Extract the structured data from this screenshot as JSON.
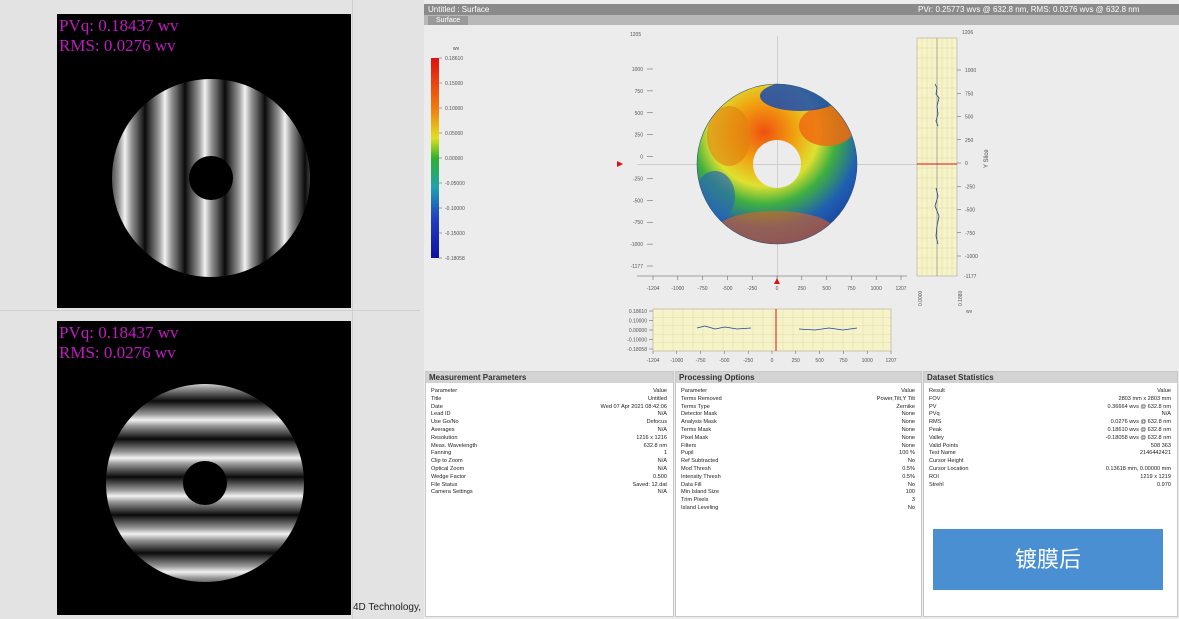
{
  "fringe_panels": [
    {
      "pvq": "PVq: 0.18437 wv",
      "rms": "RMS: 0.0276 wv",
      "fringe_orientation": "vertical"
    },
    {
      "pvq": "PVq: 0.18437 wv",
      "rms": "RMS: 0.0276 wv",
      "fringe_orientation": "horizontal"
    }
  ],
  "brand_text": "4D Technology,",
  "window": {
    "title": "Untitled : Surface",
    "stats_line": "PVr: 0.25773 wvs @ 632.8 nm, RMS: 0.0276 wvs @ 632.8 nm",
    "tab_label": "Surface"
  },
  "colorbar": {
    "unit": "wv",
    "ticks": [
      "0.18610",
      "0.15000",
      "0.10000",
      "0.05000",
      "0.00000",
      "-0.05000",
      "-0.10000",
      "-0.15000",
      "-0.18058"
    ]
  },
  "surface_map": {
    "y_ticks": [
      "1000",
      "750",
      "500",
      "250",
      "0",
      "-250",
      "-500",
      "-750",
      "-1000",
      "-1177"
    ],
    "x_ticks": [
      "-1204",
      "-1000",
      "-750",
      "-500",
      "-250",
      "0",
      "250",
      "500",
      "750",
      "1000",
      "1207"
    ],
    "top_label": "1205"
  },
  "y_slice": {
    "axis_title": "Y Slice",
    "y_ticks": [
      "1000",
      "750",
      "500",
      "250",
      "0",
      "-250",
      "-500",
      "-750",
      "-1000"
    ],
    "top_label": "1206",
    "bottom_label": "-1177",
    "x_min_label": "0.0000",
    "x_max_label": "0.1880",
    "unit": "wv"
  },
  "x_slice": {
    "y_ticks": [
      "0.18610",
      "0.10000",
      "0.00000",
      "-0.10000",
      "-0.18058"
    ],
    "x_ticks": [
      "-1204",
      "-1000",
      "-750",
      "-500",
      "-250",
      "0",
      "250",
      "500",
      "750",
      "1000",
      "1207"
    ]
  },
  "measurement_parameters": {
    "title": "Measurement Parameters",
    "header": [
      "Parameter",
      "Value"
    ],
    "rows": [
      [
        "Title",
        "Untitled"
      ],
      [
        "Date",
        "Wed 07 Apr 2021 08:42:06"
      ],
      [
        "Lead ID",
        "N/A"
      ],
      [
        "Use Go/No",
        "Defocus"
      ],
      [
        "Averages",
        "N/A"
      ],
      [
        "Resolution",
        "1216 x 1216"
      ],
      [
        "Meas. Wavelength",
        "632.8 nm"
      ],
      [
        "Fanning",
        "1"
      ],
      [
        "Clip to Zoom",
        "N/A"
      ],
      [
        "Optical Zoom",
        "N/A"
      ],
      [
        "Wedge Factor",
        "0.500"
      ],
      [
        "File Status",
        "Saved: 12.dat"
      ],
      [
        "Camera Settings",
        "N/A"
      ]
    ]
  },
  "processing_options": {
    "title": "Processing Options",
    "header": [
      "Parameter",
      "Value"
    ],
    "rows": [
      [
        "Terms Removed",
        "Power,Tilt,Y Tilt"
      ],
      [
        "Terms Type",
        "Zernike"
      ],
      [
        "Detector Mask",
        "None"
      ],
      [
        "Analysis Mask",
        "None"
      ],
      [
        "Terms Mask",
        "None"
      ],
      [
        "Pixel Mask",
        "None"
      ],
      [
        "Filters",
        "None"
      ],
      [
        "Pupil",
        "100 %"
      ],
      [
        "Ref Subtracted",
        "No"
      ],
      [
        "Mod Thresh",
        "0.5%"
      ],
      [
        "Intensity Thresh",
        "0.5%"
      ],
      [
        "Data Fill",
        "No"
      ],
      [
        "Min Island Size",
        "100"
      ],
      [
        "Trim Pixels",
        "3"
      ],
      [
        "Island Leveling",
        "No"
      ]
    ]
  },
  "dataset_statistics": {
    "title": "Dataset Statistics",
    "header": [
      "Result",
      "Value"
    ],
    "rows": [
      [
        "FOV",
        "2803 mm x 2803 mm"
      ],
      [
        "PV",
        "0.36664 wvs @ 632.8 nm"
      ],
      [
        "PVq",
        "N/A"
      ],
      [
        "RMS",
        "0.0276 wvs @ 632.8 nm"
      ],
      [
        "Peak",
        "0.18610 wvs @ 632.8 nm"
      ],
      [
        "Valley",
        "-0.18058 wvs @ 632.8 nm"
      ],
      [
        "Valid Points",
        "508 363"
      ],
      [
        "Test Name",
        "2146442421"
      ],
      [
        "Cursor Height",
        ""
      ],
      [
        "Cursor Location",
        "0.13618 mm, 0.00000 mm"
      ],
      [
        "ROI",
        "1219 x 1219"
      ],
      [
        "Strehl",
        "0.970"
      ]
    ]
  },
  "cta_button": {
    "label": "镀膜后",
    "color": "#4a8fd1"
  }
}
